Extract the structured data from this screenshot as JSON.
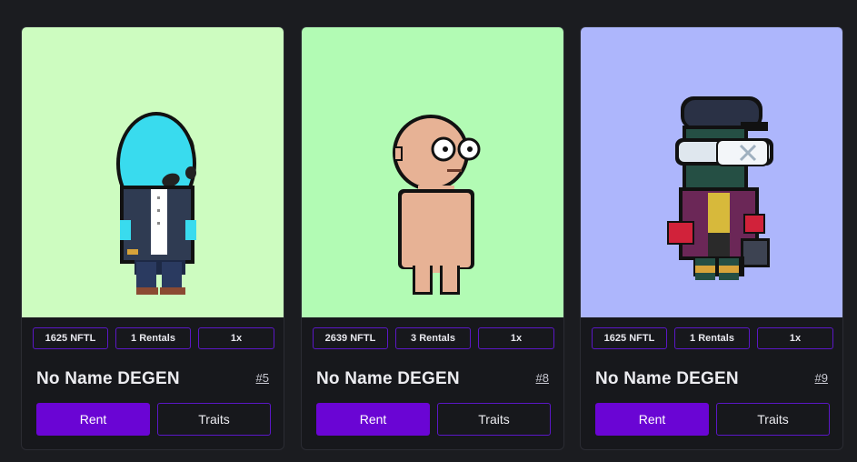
{
  "cards": [
    {
      "bg": "#cdfcc0",
      "image": "alien-degen-nft-image",
      "price": "1625 NFTL",
      "rentals": "1 Rentals",
      "multiplier": "1x",
      "name": "No Name DEGEN",
      "id": "#5",
      "rent_label": "Rent",
      "traits_label": "Traits"
    },
    {
      "bg": "#b2fbb4",
      "image": "bald-degen-nft-image",
      "price": "2639 NFTL",
      "rentals": "3 Rentals",
      "multiplier": "1x",
      "name": "No Name DEGEN",
      "id": "#8",
      "rent_label": "Rent",
      "traits_label": "Traits"
    },
    {
      "bg": "#adb6fc",
      "image": "vr-goggles-degen-nft-image",
      "price": "1625 NFTL",
      "rentals": "1 Rentals",
      "multiplier": "1x",
      "name": "No Name DEGEN",
      "id": "#9",
      "rent_label": "Rent",
      "traits_label": "Traits"
    }
  ],
  "colors": {
    "page_bg": "#1b1c20",
    "card_bg": "#17181c",
    "accent": "#6a05d4",
    "accent_border": "#5b17c6"
  }
}
